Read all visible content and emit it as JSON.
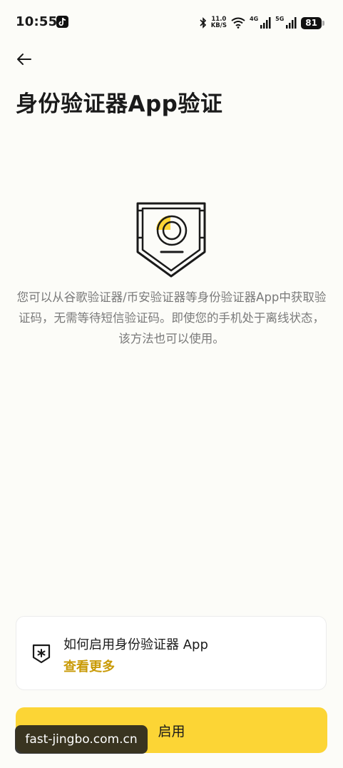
{
  "status_bar": {
    "time": "10:55",
    "net_speed_value": "11.0",
    "net_speed_unit": "KB/S",
    "signal1_label": "4G",
    "signal2_label": "5G",
    "battery": "81"
  },
  "header": {
    "title": "身份验证器App验证"
  },
  "main": {
    "description": "您可以从谷歌验证器/币安验证器等身份验证器App中获取验证码，无需等待短信验证码。即使您的手机处于离线状态，该方法也可以使用。"
  },
  "info_card": {
    "title": "如何启用身份验证器 App",
    "link": "查看更多"
  },
  "footer": {
    "enable_button": "启用"
  },
  "watermark": "fast-jingbo.com.cn",
  "colors": {
    "accent": "#fcd535",
    "link": "#c99a06",
    "background": "#fcfcf8",
    "text_secondary": "#7a7a7a"
  }
}
